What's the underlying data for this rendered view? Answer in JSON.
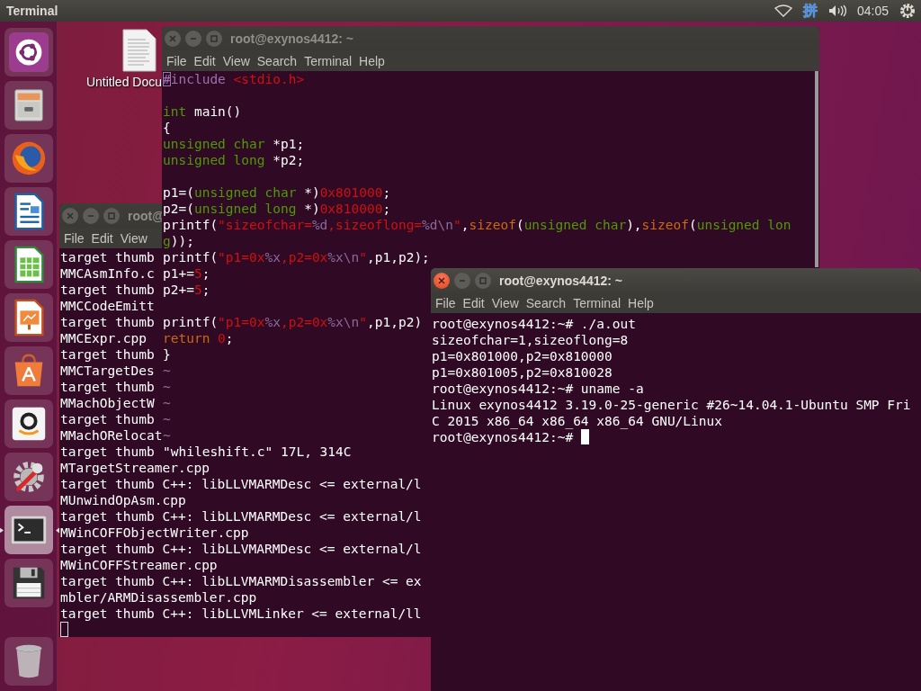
{
  "top_bar": {
    "app_title": "Terminal",
    "input_method": "拼",
    "clock": "04:05"
  },
  "launcher": [
    {
      "kind": "dash",
      "active": false
    },
    {
      "kind": "files",
      "active": false
    },
    {
      "kind": "browser",
      "active": false
    },
    {
      "kind": "writer",
      "active": false
    },
    {
      "kind": "calc",
      "active": false
    },
    {
      "kind": "impress",
      "active": false
    },
    {
      "kind": "software",
      "active": false
    },
    {
      "kind": "amazon",
      "active": false
    },
    {
      "kind": "settings",
      "active": false
    },
    {
      "kind": "terminal",
      "active": true
    },
    {
      "kind": "floppy",
      "active": false
    },
    {
      "kind": "trash",
      "active": false
    }
  ],
  "desktop_icons": [
    {
      "label": "Untitled Docu"
    }
  ],
  "windows": [
    {
      "kind": "shell",
      "title": "root@",
      "active": false,
      "menu": [
        "File",
        "Edit",
        "View"
      ],
      "lines": [
        "target thumb",
        "MMCAsmInfo.c",
        "target thumb",
        "MMCCodeEmitt",
        "target thumb",
        "MMCExpr.cpp",
        "target thumb",
        "MMCTargetDes",
        "target thumb",
        "MMachObjectW",
        "target thumb",
        "MMachORelocat",
        "target thumb",
        "MTargetStreamer.cpp",
        "target thumb C++: libLLVMARMDesc <= external/l",
        "MUnwindOpAsm.cpp",
        "target thumb C++: libLLVMARMDesc <= external/l",
        "MWinCOFFObjectWriter.cpp",
        "target thumb C++: libLLVMARMDesc <= external/l",
        "MWinCOFFStreamer.cpp",
        "target thumb C++: libLLVMARMDisassembler <= ex",
        "mbler/ARMDisassembler.cpp",
        "target thumb C++: libLLVMLinker <= external/ll",
        {
          "cursor": true
        }
      ]
    },
    {
      "kind": "editor",
      "title": "root@exynos4412: ~",
      "active": false,
      "menu": [
        "File",
        "Edit",
        "View",
        "Search",
        "Terminal",
        "Help"
      ],
      "lines": [
        [
          {
            "text": "#",
            "kind": "cursor"
          },
          {
            "text": "include",
            "kind": "preproc"
          },
          {
            "text": " <stdio.h>",
            "kind": "string"
          }
        ],
        {
          "kind": "blank"
        },
        [
          {
            "text": "int",
            "kind": "type"
          },
          {
            "text": " main()",
            "kind": "plain"
          }
        ],
        [
          {
            "text": "{",
            "kind": "plain"
          }
        ],
        [
          {
            "text": "unsigned char",
            "kind": "type"
          },
          {
            "text": " *p1;",
            "kind": "plain"
          }
        ],
        [
          {
            "text": "unsigned long",
            "kind": "type"
          },
          {
            "text": " *p2;",
            "kind": "plain"
          }
        ],
        {
          "kind": "blank"
        },
        [
          {
            "text": "p1=(",
            "kind": "plain"
          },
          {
            "text": "unsigned char",
            "kind": "type"
          },
          {
            "text": " *)",
            "kind": "plain"
          },
          {
            "text": "0x801000",
            "kind": "number"
          },
          {
            "text": ";",
            "kind": "plain"
          }
        ],
        [
          {
            "text": "p2=(",
            "kind": "plain"
          },
          {
            "text": "unsigned long",
            "kind": "type"
          },
          {
            "text": " *)",
            "kind": "plain"
          },
          {
            "text": "0x810000",
            "kind": "number"
          },
          {
            "text": ";",
            "kind": "plain"
          }
        ],
        [
          {
            "text": "printf(",
            "kind": "plain"
          },
          {
            "text": "\"sizeofchar=",
            "kind": "string"
          },
          {
            "text": "%d",
            "kind": "special"
          },
          {
            "text": ",sizeoflong=",
            "kind": "string"
          },
          {
            "text": "%d\\n",
            "kind": "special"
          },
          {
            "text": "\"",
            "kind": "string"
          },
          {
            "text": ",",
            "kind": "plain"
          },
          {
            "text": "sizeof",
            "kind": "keyword"
          },
          {
            "text": "(",
            "kind": "plain"
          },
          {
            "text": "unsigned char",
            "kind": "type"
          },
          {
            "text": "),",
            "kind": "plain"
          },
          {
            "text": "sizeof",
            "kind": "keyword"
          },
          {
            "text": "(",
            "kind": "plain"
          },
          {
            "text": "unsigned lon",
            "kind": "type"
          }
        ],
        [
          {
            "text": "g",
            "kind": "type"
          },
          {
            "text": "));",
            "kind": "plain"
          }
        ],
        [
          {
            "text": "printf(",
            "kind": "plain"
          },
          {
            "text": "\"p1=0x",
            "kind": "string"
          },
          {
            "text": "%x",
            "kind": "special"
          },
          {
            "text": ",p2=0x",
            "kind": "string"
          },
          {
            "text": "%x\\n",
            "kind": "special"
          },
          {
            "text": "\"",
            "kind": "string"
          },
          {
            "text": ",p1,p2);",
            "kind": "plain"
          }
        ],
        [
          {
            "text": "p1+=",
            "kind": "plain"
          },
          {
            "text": "5",
            "kind": "number"
          },
          {
            "text": ";",
            "kind": "plain"
          }
        ],
        [
          {
            "text": "p2+=",
            "kind": "plain"
          },
          {
            "text": "5",
            "kind": "number"
          },
          {
            "text": ";",
            "kind": "plain"
          }
        ],
        {
          "kind": "blank"
        },
        [
          {
            "text": "printf(",
            "kind": "plain"
          },
          {
            "text": "\"p1=0x",
            "kind": "string"
          },
          {
            "text": "%x",
            "kind": "special"
          },
          {
            "text": ",p2=0x",
            "kind": "string"
          },
          {
            "text": "%x\\n",
            "kind": "special"
          },
          {
            "text": "\"",
            "kind": "string"
          },
          {
            "text": ",p1,p2)",
            "kind": "plain"
          }
        ],
        [
          {
            "text": "return",
            "kind": "keyword"
          },
          {
            "text": " 0",
            "kind": "number"
          },
          {
            "text": ";",
            "kind": "plain"
          }
        ],
        [
          {
            "text": "}",
            "kind": "plain"
          }
        ],
        [
          {
            "text": "~",
            "kind": "filler"
          }
        ],
        [
          {
            "text": "~",
            "kind": "filler"
          }
        ],
        [
          {
            "text": "~",
            "kind": "filler"
          }
        ],
        [
          {
            "text": "~",
            "kind": "filler"
          }
        ],
        [
          {
            "text": "~",
            "kind": "filler"
          }
        ]
      ],
      "status": "\"whileshift.c\" 17L, 314C"
    },
    {
      "kind": "shell",
      "title": "root@exynos4412: ~",
      "active": true,
      "menu": [
        "File",
        "Edit",
        "View",
        "Search",
        "Terminal",
        "Help"
      ],
      "lines": [
        "root@exynos4412:~# ./a.out",
        "sizeofchar=1,sizeoflong=8",
        "p1=0x801000,p2=0x810000",
        "p1=0x801005,p2=0x810028",
        "root@exynos4412:~# uname -a",
        "Linux exynos4412 3.19.0-25-generic #26~14.04.1-Ubuntu SMP Fri",
        "C 2015 x86_64 x86_64 x86_64 GNU/Linux",
        {
          "text": "root@exynos4412:~#",
          "cursor": true
        }
      ]
    }
  ]
}
